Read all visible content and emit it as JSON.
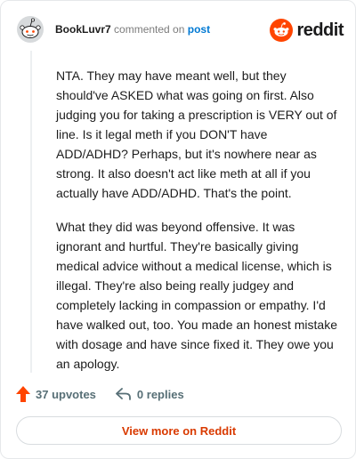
{
  "comment": {
    "username": "BookLuvr7",
    "action_text": "commented on",
    "post_link": "post",
    "paragraphs": [
      "NTA. They may have meant well, but they should've ASKED what was going on first. Also judging you for taking a prescription is VERY out of line. Is it legal meth if you DON'T have ADD/ADHD? Perhaps, but it's nowhere near as strong. It also doesn't act like meth at all if you actually have ADD/ADHD. That's the point.",
      "What they did was beyond offensive. It was ignorant and hurtful. They're basically giving medical advice without a medical license, which is illegal. They're also being really judgey and completely lacking in compassion or empathy. I'd have walked out, too. You made an honest mistake with dosage and have since fixed it. They owe you an apology."
    ]
  },
  "brand": {
    "name": "reddit",
    "color": "#ff4500"
  },
  "footer": {
    "upvotes": "37 upvotes",
    "replies": "0 replies"
  },
  "cta": {
    "label": "View more on Reddit"
  }
}
